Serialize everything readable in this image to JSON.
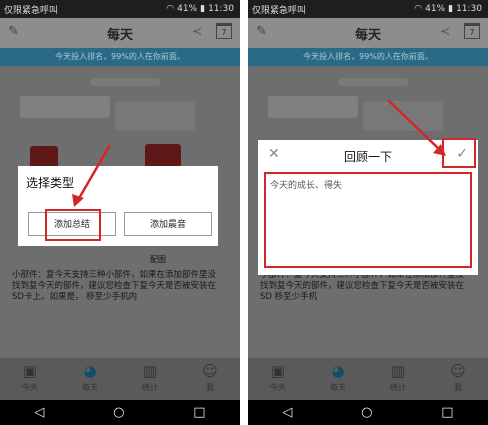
{
  "status_bar": {
    "carrier": "仅限紧急呼叫",
    "battery": "41%",
    "time": "11:30"
  },
  "app_bar": {
    "title": "每天",
    "calendar_day": "7"
  },
  "banner": {
    "text": "今天投入排名，99%的人在你前面。"
  },
  "left_screen": {
    "dialog": {
      "title": "选择类型",
      "buttons": [
        {
          "label": "添加总结"
        },
        {
          "label": "添加晨音"
        }
      ]
    },
    "partial_text": "配图",
    "body_text": "小部件：复今天支持三种小部件，如果在添加部件里没找到复今天的部件，建议您检查下复今天是否被安装在SD卡上。如果是，\n移至少手机内"
  },
  "right_screen": {
    "dialog": {
      "title": "回顾一下",
      "textarea_placeholder": "今天的成长、得失"
    },
    "body_text": "小部件：复今天支持三种小部件，如果在添加部件里没找到复今天的部件，建议您检查下复今天是否被安装在SD\n移至少手机"
  },
  "tabs": [
    {
      "label": "今天",
      "icon": "calendar-check-icon"
    },
    {
      "label": "每天",
      "icon": "pie-chart-icon"
    },
    {
      "label": "统计",
      "icon": "bar-chart-icon"
    },
    {
      "label": "我",
      "icon": "person-icon"
    }
  ],
  "nav_bar": {
    "back": "◁",
    "home": "○",
    "recents": "□"
  },
  "colors": {
    "highlight": "#d42626",
    "banner": "#2a6a86",
    "overlay": "#6e6e6e"
  }
}
